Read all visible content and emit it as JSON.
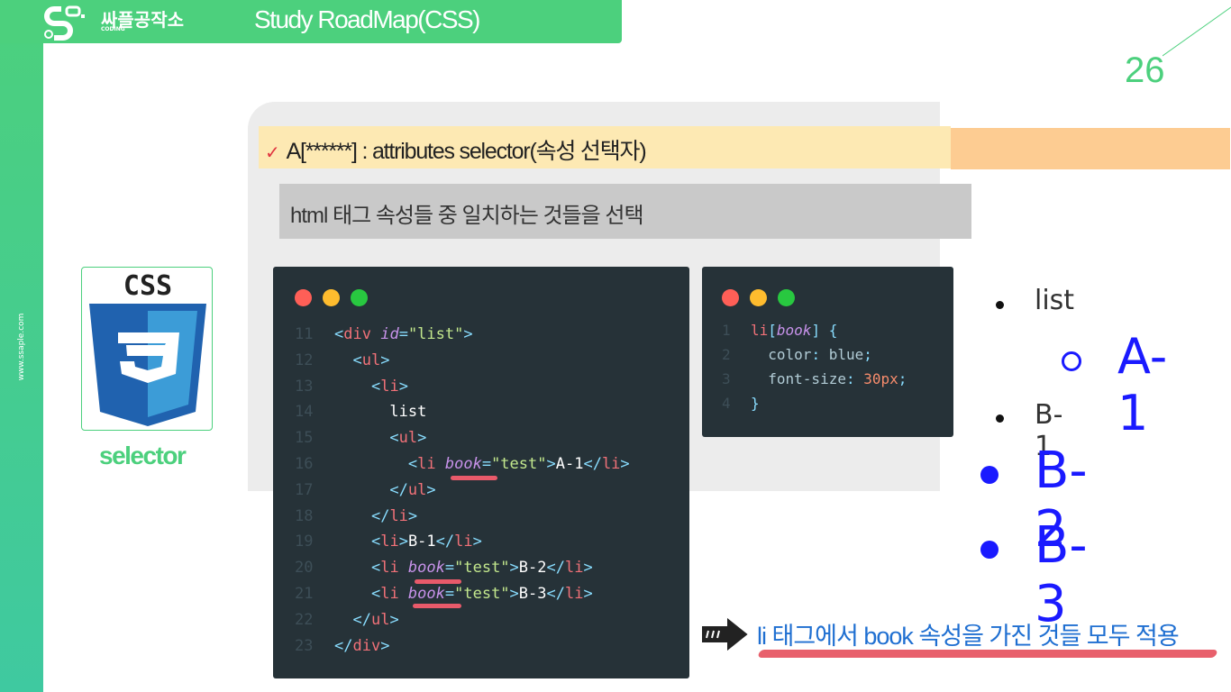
{
  "sidebar": {
    "website": "www.ssaple.com"
  },
  "header": {
    "brand": "싸플공작소",
    "brand_sub": "CODING",
    "title": "Study RoadMap(CSS)"
  },
  "page_number": "26",
  "topic": {
    "check": "✓",
    "title": "A[******] : attributes selector(속성 선택자)",
    "description": "html 태그 속성들 중 일치하는 것들을 선택"
  },
  "logo": {
    "text": "CSS",
    "number": "3",
    "caption": "selector"
  },
  "html_code": {
    "lines": [
      {
        "n": "11",
        "parts": [
          [
            "t",
            "<"
          ],
          [
            "tg",
            "div"
          ],
          [
            "",
            ""
          ],
          [
            "at",
            " id"
          ],
          [
            "t",
            "="
          ],
          [
            "st",
            "\"list\""
          ],
          [
            "t",
            ">"
          ]
        ]
      },
      {
        "n": "12",
        "parts": [
          [
            "",
            "  "
          ],
          [
            "t",
            "<"
          ],
          [
            "tg",
            "ul"
          ],
          [
            "t",
            ">"
          ]
        ]
      },
      {
        "n": "13",
        "parts": [
          [
            "",
            "    "
          ],
          [
            "t",
            "<"
          ],
          [
            "tg",
            "li"
          ],
          [
            "t",
            ">"
          ]
        ]
      },
      {
        "n": "14",
        "parts": [
          [
            "",
            "      list"
          ]
        ]
      },
      {
        "n": "15",
        "parts": [
          [
            "",
            "      "
          ],
          [
            "t",
            "<"
          ],
          [
            "tg",
            "ul"
          ],
          [
            "t",
            ">"
          ]
        ]
      },
      {
        "n": "16",
        "parts": [
          [
            "",
            "        "
          ],
          [
            "t",
            "<"
          ],
          [
            "tg",
            "li"
          ],
          [
            "at",
            " book"
          ],
          [
            "t",
            "="
          ],
          [
            "st",
            "\"test\""
          ],
          [
            "t",
            ">"
          ],
          [
            "",
            "A-1"
          ],
          [
            "t",
            "</"
          ],
          [
            "tg",
            "li"
          ],
          [
            "t",
            ">"
          ]
        ]
      },
      {
        "n": "17",
        "parts": [
          [
            "",
            "      "
          ],
          [
            "t",
            "</"
          ],
          [
            "tg",
            "ul"
          ],
          [
            "t",
            ">"
          ]
        ]
      },
      {
        "n": "18",
        "parts": [
          [
            "",
            "    "
          ],
          [
            "t",
            "</"
          ],
          [
            "tg",
            "li"
          ],
          [
            "t",
            ">"
          ]
        ]
      },
      {
        "n": "19",
        "parts": [
          [
            "",
            "    "
          ],
          [
            "t",
            "<"
          ],
          [
            "tg",
            "li"
          ],
          [
            "t",
            ">"
          ],
          [
            "",
            "B-1"
          ],
          [
            "t",
            "</"
          ],
          [
            "tg",
            "li"
          ],
          [
            "t",
            ">"
          ]
        ]
      },
      {
        "n": "20",
        "parts": [
          [
            "",
            "    "
          ],
          [
            "t",
            "<"
          ],
          [
            "tg",
            "li"
          ],
          [
            "at",
            " book"
          ],
          [
            "t",
            "="
          ],
          [
            "st",
            "\"test\""
          ],
          [
            "t",
            ">"
          ],
          [
            "",
            "B-2"
          ],
          [
            "t",
            "</"
          ],
          [
            "tg",
            "li"
          ],
          [
            "t",
            ">"
          ]
        ]
      },
      {
        "n": "21",
        "parts": [
          [
            "",
            "    "
          ],
          [
            "t",
            "<"
          ],
          [
            "tg",
            "li"
          ],
          [
            "at",
            " book"
          ],
          [
            "t",
            "="
          ],
          [
            "st",
            "\"test\""
          ],
          [
            "t",
            ">"
          ],
          [
            "",
            "B-3"
          ],
          [
            "t",
            "</"
          ],
          [
            "tg",
            "li"
          ],
          [
            "t",
            ">"
          ]
        ]
      },
      {
        "n": "22",
        "parts": [
          [
            "",
            "  "
          ],
          [
            "t",
            "</"
          ],
          [
            "tg",
            "ul"
          ],
          [
            "t",
            ">"
          ]
        ]
      },
      {
        "n": "23",
        "parts": [
          [
            "t",
            "</"
          ],
          [
            "tg",
            "div"
          ],
          [
            "t",
            ">"
          ]
        ]
      }
    ]
  },
  "css_code": {
    "lines": [
      {
        "n": "1",
        "parts": [
          [
            "tg",
            "li"
          ],
          [
            "t",
            "["
          ],
          [
            "at",
            "book"
          ],
          [
            "t",
            "] {"
          ]
        ]
      },
      {
        "n": "2",
        "parts": [
          [
            "pr",
            "  color"
          ],
          [
            "t",
            ": "
          ],
          [
            "pr",
            "blue"
          ],
          [
            "t",
            ";"
          ]
        ]
      },
      {
        "n": "3",
        "parts": [
          [
            "pr",
            "  font-size"
          ],
          [
            "t",
            ": "
          ],
          [
            "vl",
            "30px"
          ],
          [
            "t",
            ";"
          ]
        ]
      },
      {
        "n": "4",
        "parts": [
          [
            "t",
            "}"
          ]
        ]
      }
    ]
  },
  "window_dot_colors": [
    "#ff5f57",
    "#febc2e",
    "#28c840"
  ],
  "rendered": {
    "list": "list",
    "a1": "A-1",
    "b1": "B-1",
    "b2": "B-2",
    "b3": "B-3",
    "highlight_color": "#1a1aff"
  },
  "note": "li 태그에서 book 속성을 가진 것들 모두 적용"
}
